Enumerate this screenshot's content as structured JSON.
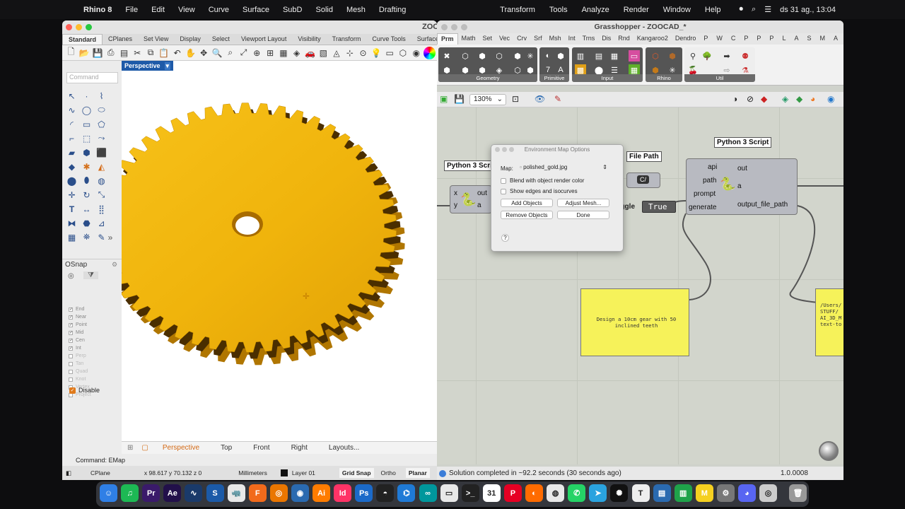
{
  "menubar": {
    "apple": "",
    "app": "Rhino 8",
    "items": [
      "File",
      "Edit",
      "View",
      "Curve",
      "Surface",
      "SubD",
      "Solid",
      "Mesh",
      "Drafting"
    ],
    "right_items": [
      "Transform",
      "Tools",
      "Analyze",
      "Render",
      "Window",
      "Help"
    ],
    "clock": "ds 31 ag., 13:04"
  },
  "rhino": {
    "title": "ZOO",
    "tabs": [
      "Standard",
      "CPlanes",
      "Set View",
      "Display",
      "Select",
      "Viewport Layout",
      "Visibility",
      "Transform",
      "Curve Tools",
      "Surface Tools"
    ],
    "command_placeholder": "Command",
    "viewport_label": "Perspective",
    "osnap": {
      "header": "OSnap",
      "items": [
        {
          "label": "End",
          "checked": true
        },
        {
          "label": "Near",
          "checked": true
        },
        {
          "label": "Point",
          "checked": true
        },
        {
          "label": "Mid",
          "checked": true
        },
        {
          "label": "Cen",
          "checked": true
        },
        {
          "label": "Int",
          "checked": true
        },
        {
          "label": "Perp",
          "checked": false
        },
        {
          "label": "Tan",
          "checked": false
        },
        {
          "label": "Quad",
          "checked": false
        },
        {
          "label": "Knot",
          "checked": false
        },
        {
          "label": "Vertex",
          "checked": false
        },
        {
          "label": "Project",
          "checked": false
        }
      ],
      "disable": "Disable"
    },
    "viewport_tabs": [
      "Perspective",
      "Top",
      "Front",
      "Right",
      "Layouts..."
    ],
    "command_line": "Command: EMap",
    "status": {
      "cplane": "CPlane",
      "coords": "x 98.617  y 70.132  z 0",
      "units": "Millimeters",
      "layer": "Layer 01",
      "grid_snap": "Grid Snap",
      "ortho": "Ortho",
      "planar": "Planar"
    }
  },
  "grasshopper": {
    "title": "Grasshopper - ZOOCAD_*",
    "tabs": [
      "Prm",
      "Math",
      "Set",
      "Vec",
      "Crv",
      "Srf",
      "Msh",
      "Int",
      "Trns",
      "Dis",
      "Rnd",
      "Kangaroo2",
      "Dendro",
      "P",
      "W",
      "C",
      "P",
      "P",
      "P",
      "L",
      "A",
      "S",
      "M",
      "A"
    ],
    "ribbon_groups": [
      "Geometry",
      "Primitive",
      "Input",
      "Rhino",
      "Util"
    ],
    "zoom": "130%",
    "components": {
      "python_left_label": "Python 3 Script",
      "python_left_inputs": [
        "x",
        "y"
      ],
      "python_left_outputs": [
        "out",
        "a"
      ],
      "file_path_label": "File Path",
      "file_path_icon": "C/",
      "toggle_label": "Toggle",
      "toggle_value": "True",
      "python_main_label": "Python 3 Script",
      "python_main_inputs": [
        "api",
        "path",
        "prompt",
        "generate"
      ],
      "python_main_outputs": [
        "out",
        "a",
        "output_file_path"
      ],
      "panel_text": "Design a 10cm gear with 50 inclined teeth",
      "panel_right_text": "/Users/\nSTUFF/\nAI_3D_M\ntext-to"
    },
    "status": "Solution completed in ~92.2 seconds (30 seconds ago)",
    "version": "1.0.0008"
  },
  "dialog": {
    "title": "Environment Map Options",
    "map_label": "Map:",
    "map_value": "polished_gold.jpg",
    "blend": "Blend with object render color",
    "show_edges": "Show edges and isocurves",
    "add_objects": "Add Objects",
    "adjust_mesh": "Adjust Mesh...",
    "remove_objects": "Remove Objects",
    "done": "Done",
    "help": "?"
  },
  "dock": [
    "Finder",
    "Spotify",
    "Premiere Pro",
    "After Effects",
    "Curve",
    "SketchUp",
    "Rhino",
    "Fusion",
    "Blender",
    "Proxyman",
    "Illustrator",
    "InDesign",
    "Photoshop",
    "GitHub",
    "VS Code",
    "Arduino",
    "Notes",
    "Terminal",
    "Calendar",
    "Pinterest",
    "Firefox",
    "Chrome",
    "WhatsApp",
    "Telegram",
    "ChatGPT",
    "Typora",
    "Preview",
    "Numbers",
    "Miro",
    "Settings",
    "Discord",
    "Grasshopper",
    "Trash"
  ],
  "colors": {
    "gold": "#f2b60f",
    "gold_dark": "#b07600",
    "rhino_blue": "#1e5aa8",
    "panel_yellow": "#f6f25a",
    "canvas": "#d2d5cc"
  }
}
